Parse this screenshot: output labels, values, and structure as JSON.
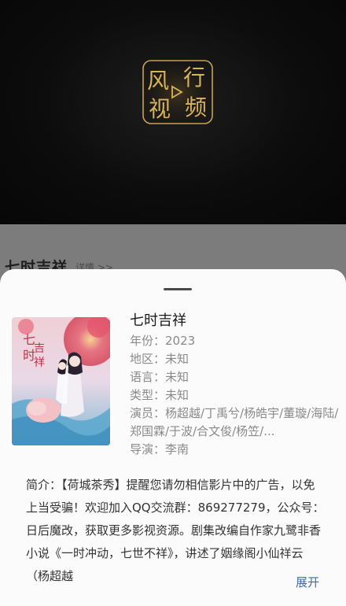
{
  "player": {
    "logo_text": [
      "风",
      "行",
      "视",
      "频"
    ]
  },
  "behind": {
    "title": "七时吉祥",
    "detail_link": "详情 >>"
  },
  "movie": {
    "title": "七时吉祥",
    "year": "年份：2023",
    "region": "地区：未知",
    "language": "语言：未知",
    "genre": "类型：未知",
    "cast": "演员：杨超越/丁禹兮/杨皓宇/董璇/海陆/郑国霖/于波/合文俊/杨笠/...",
    "director": "导演：李南",
    "description": "简介：【荷城茶秀】提醒您请勿相信影片中的广告，以免上当受骗！欢迎加入QQ交流群：869277279，公众号：日后魔改，获取更多影视资源。剧集改编自作家九鹭非香小说《一时冲动，七世不祥》，讲述了姻缘阁小仙祥云（杨超越",
    "expand_label": "展开"
  },
  "colors": {
    "logo_gold": "#c9a24a",
    "link_blue": "#3c6bb8"
  }
}
